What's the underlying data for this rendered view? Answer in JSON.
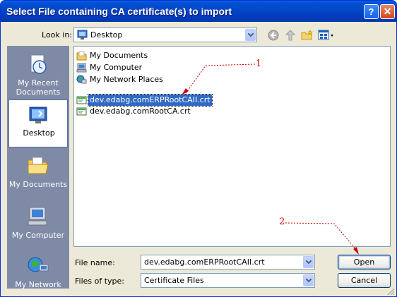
{
  "window": {
    "title": "Select File containing CA certificate(s) to import",
    "help_label": "?",
    "close_label": "✕"
  },
  "toolbar": {
    "look_in_label": "Look in:",
    "look_in_value": "Desktop",
    "icons": [
      "back-icon",
      "up-folder-icon",
      "new-folder-icon",
      "views-menu-icon"
    ]
  },
  "places": [
    {
      "label": "My Recent Documents",
      "icon": "recent-documents-icon"
    },
    {
      "label": "Desktop",
      "icon": "desktop-icon",
      "selected": true
    },
    {
      "label": "My Documents",
      "icon": "my-documents-folder-icon"
    },
    {
      "label": "My Computer",
      "icon": "computer-icon"
    },
    {
      "label": "My Network",
      "icon": "network-icon"
    }
  ],
  "files": [
    {
      "name": "My Documents",
      "icon": "folder-icon"
    },
    {
      "name": "My Computer",
      "icon": "computer-icon"
    },
    {
      "name": "My Network Places",
      "icon": "network-places-icon"
    },
    {
      "name": "dev.edabg.comERPRootCAII.crt",
      "icon": "certificate-icon",
      "selected": true
    },
    {
      "name": "dev.edabg.comRootCA.crt",
      "icon": "certificate-icon"
    }
  ],
  "form": {
    "file_name_label": "File name:",
    "file_name_value": "dev.edabg.comERPRootCAII.crt",
    "file_type_label": "Files of type:",
    "file_type_value": "Certificate Files"
  },
  "buttons": {
    "open_label": "Open",
    "cancel_label": "Cancel"
  },
  "annotations": {
    "marker_1": "1",
    "marker_2": "2",
    "color": "#cc0000"
  },
  "colors": {
    "titlebar": "#0046d5",
    "selection": "#316ac5",
    "places_bar": "#7f8ba6",
    "dialog_bg": "#ece9d8"
  }
}
